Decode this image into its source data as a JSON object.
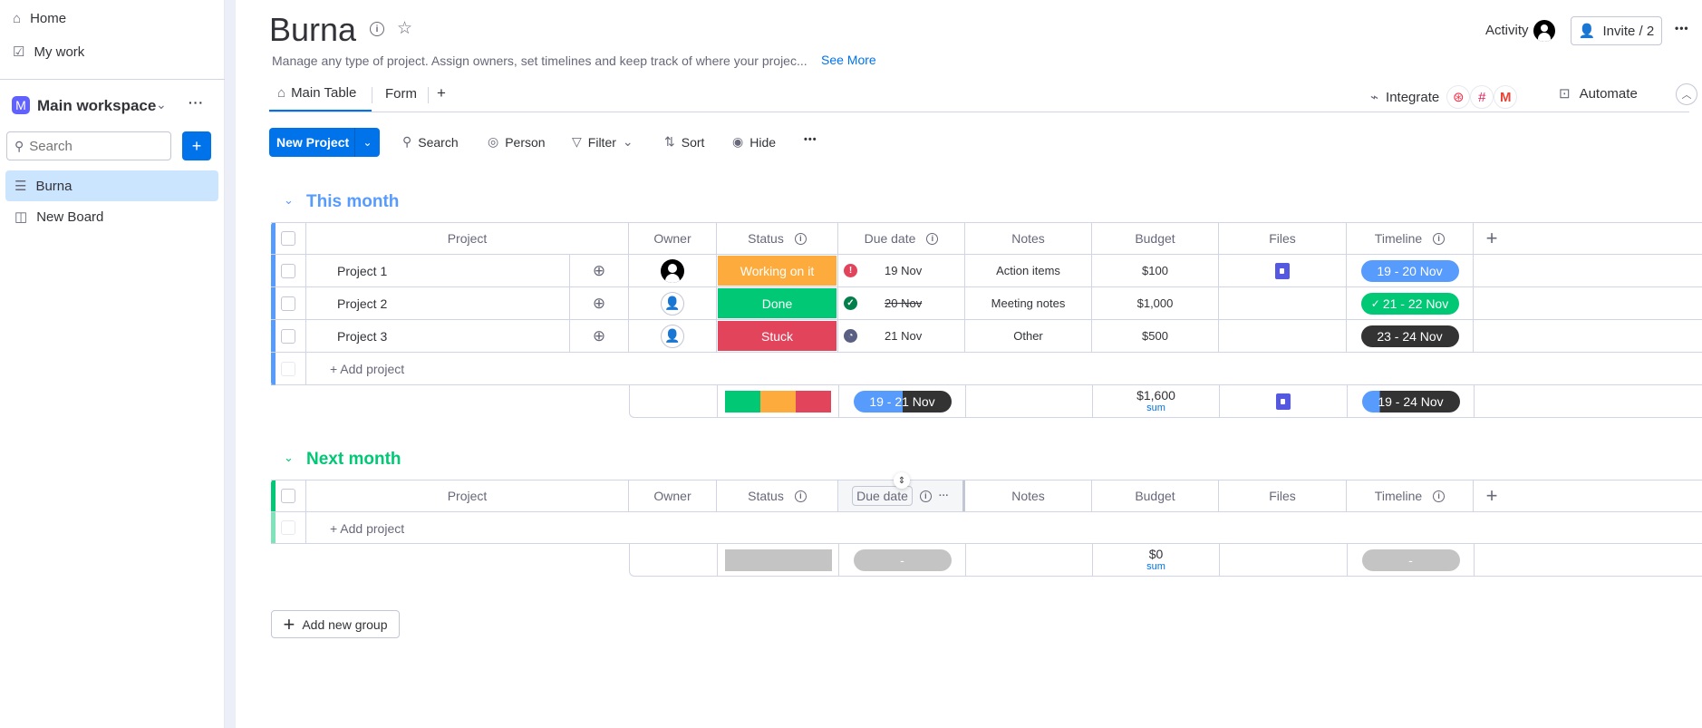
{
  "sidebar": {
    "home": "Home",
    "my_work": "My work",
    "workspace": "Main workspace",
    "workspace_initial": "M",
    "search_placeholder": "Search",
    "add": "+",
    "boards": [
      {
        "label": "Burna",
        "active": true
      },
      {
        "label": "New Board",
        "active": false
      }
    ]
  },
  "header": {
    "title": "Burna",
    "description": "Manage any type of project. Assign owners, set timelines and keep track of where your projec...",
    "see_more": "See More",
    "activity": "Activity",
    "invite": "Invite / 2",
    "more": "•••"
  },
  "tabs": {
    "items": [
      "Main Table",
      "Form"
    ],
    "add": "+",
    "integrate": "Integrate",
    "automate": "Automate"
  },
  "toolbar": {
    "new_item": "New Project",
    "search": "Search",
    "person": "Person",
    "filter": "Filter",
    "sort": "Sort",
    "hide": "Hide",
    "more": "•••"
  },
  "columns": {
    "project": "Project",
    "owner": "Owner",
    "status": "Status",
    "due": "Due date",
    "notes": "Notes",
    "budget": "Budget",
    "files": "Files",
    "timeline": "Timeline",
    "add": "+"
  },
  "colors": {
    "working": "#fdab3d",
    "done": "#00c875",
    "stuck": "#e2445c",
    "blue": "#579bfc",
    "dark": "#333333",
    "group1": "#579bfc",
    "group2": "#00c875"
  },
  "groups": [
    {
      "title": "This month",
      "add_item": "+ Add project",
      "rows": [
        {
          "name": "Project 1",
          "owner": "filled",
          "status": "Working on it",
          "status_color": "#fdab3d",
          "due": "19 Nov",
          "due_icon": "overdue",
          "notes": "Action items",
          "budget": "$100",
          "file": true,
          "timeline": "19 - 20 Nov",
          "timeline_color": "#579bfc"
        },
        {
          "name": "Project 2",
          "owner": "empty",
          "status": "Done",
          "status_color": "#00c875",
          "due": "20 Nov",
          "due_icon": "done",
          "notes": "Meeting notes",
          "budget": "$1,000",
          "file": false,
          "timeline": "21 - 22 Nov",
          "timeline_color": "#00c875"
        },
        {
          "name": "Project 3",
          "owner": "empty",
          "status": "Stuck",
          "status_color": "#e2445c",
          "due": "21 Nov",
          "due_icon": "pending",
          "notes": "Other",
          "budget": "$500",
          "file": false,
          "timeline": "23 - 24 Nov",
          "timeline_color": "#333333"
        }
      ],
      "summary": {
        "due": "19 - 21 Nov",
        "budget": "$1,600",
        "budget_label": "sum",
        "timeline": "19 - 24 Nov"
      }
    },
    {
      "title": "Next month",
      "add_item": "+ Add project",
      "rows": [],
      "summary": {
        "due": "-",
        "budget": "$0",
        "budget_label": "sum",
        "timeline": "-"
      }
    }
  ],
  "add_group": "Add new group"
}
